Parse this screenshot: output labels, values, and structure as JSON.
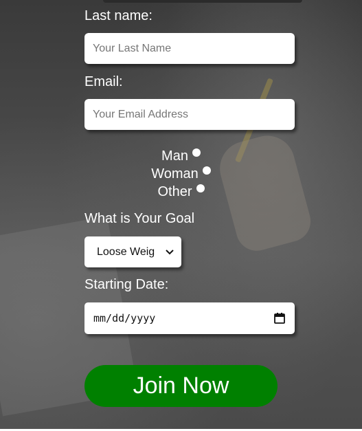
{
  "form": {
    "last_name": {
      "label": "Last name:",
      "placeholder": "Your Last Name"
    },
    "email": {
      "label": "Email:",
      "placeholder": "Your Email Address"
    },
    "gender_options": [
      {
        "label": "Man",
        "selected": false
      },
      {
        "label": "Woman",
        "selected": false
      },
      {
        "label": "Other",
        "selected": false
      }
    ],
    "goal": {
      "label": "What is Your Goal",
      "selected_value": "Loose Weig"
    },
    "start_date": {
      "label": "Starting Date:",
      "value": "mm/dd/yyyy"
    },
    "submit_label": "Join Now"
  },
  "colors": {
    "submit_button": "#008000",
    "label_text": "#ffffff",
    "input_background": "#ffffff"
  },
  "icons": {
    "select_arrow": "chevron-down-icon",
    "date_picker": "calendar-icon"
  }
}
